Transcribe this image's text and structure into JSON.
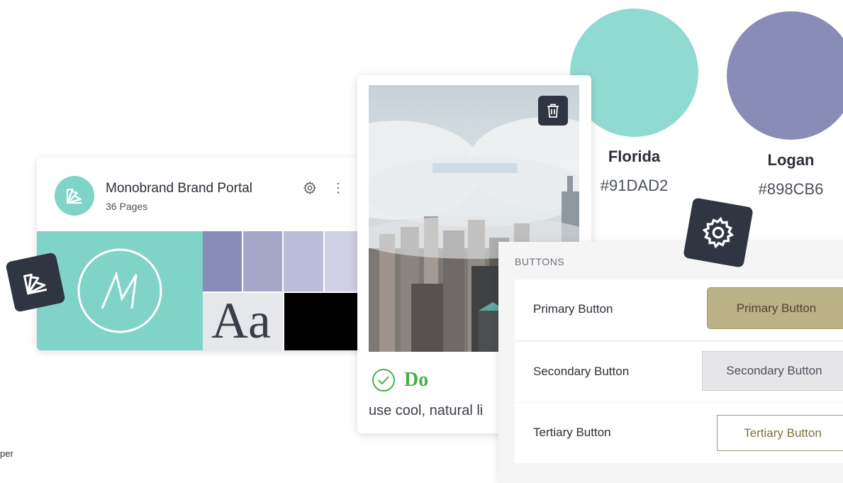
{
  "portal": {
    "title": "Monobrand Brand Portal",
    "pages": "36 Pages",
    "type_sample": "Aa",
    "swatch_colors": [
      "#8a8cb9",
      "#a5a7c9",
      "#babcd8",
      "#cfd0e4"
    ],
    "logo_color": "#7fd3c7"
  },
  "guideline": {
    "label": "Do",
    "text": "use cool, natural li"
  },
  "colors": [
    {
      "name": "Florida",
      "hex": "#91DAD2",
      "value": "#91DAD2"
    },
    {
      "name": "Logan",
      "hex": "#898CB6",
      "value": "#898CB6"
    }
  ],
  "buttons": {
    "heading": "BUTTONS",
    "rows": [
      {
        "label": "Primary Button",
        "button": "Primary Button"
      },
      {
        "label": "Secondary Button",
        "button": "Secondary Button"
      },
      {
        "label": "Tertiary Button",
        "button": "Tertiary Button"
      }
    ]
  },
  "footer": {
    "text": "per"
  },
  "icons": [
    "fan-palette-icon",
    "gear-icon",
    "more-vertical-icon",
    "trash-icon",
    "check-circle-icon"
  ]
}
